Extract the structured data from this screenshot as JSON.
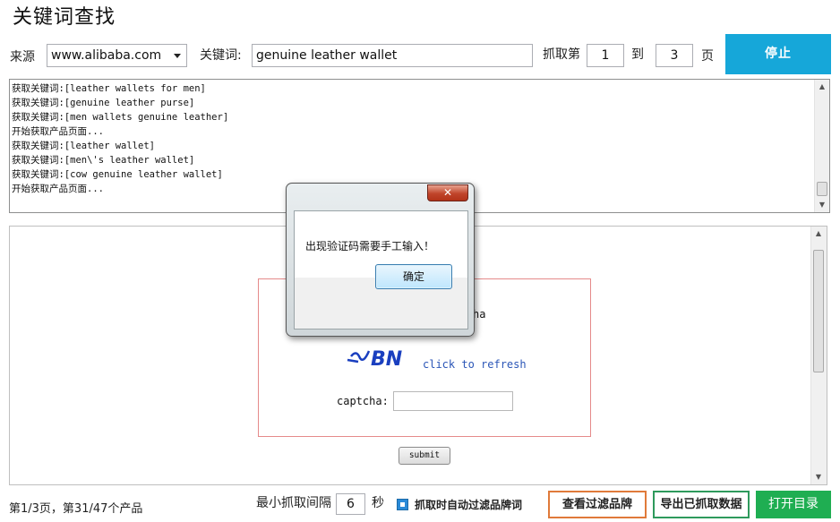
{
  "app": {
    "title": "关键词查找"
  },
  "toolbar": {
    "source_label": "来源",
    "source_value": "www.alibaba.com",
    "keyword_label": "关键词:",
    "keyword_value": "genuine leather wallet",
    "fetch_label": "抓取第",
    "page_from": "1",
    "to_label": "到",
    "page_to": "3",
    "page_unit": "页",
    "stop_label": "停止"
  },
  "log": {
    "lines": [
      "获取关键词:[leather wallets for men]",
      "获取关键词:[genuine leather purse]",
      "获取关键词:[men wallets genuine leather]",
      "开始获取产品页面...",
      "获取关键词:[leather wallet]",
      "获取关键词:[men\\'s leather wallet]",
      "获取关键词:[cow genuine leather wallet]",
      "开始获取产品页面..."
    ]
  },
  "captcha": {
    "partial_text": "ha",
    "image_text": "ﾉ‸BN",
    "refresh_label": "click to refresh",
    "input_label": "captcha:",
    "input_value": "",
    "submit_label": "submit"
  },
  "dialog": {
    "close_label": "✕",
    "message": "出现验证码需要手工输入！",
    "ok_label": "确定"
  },
  "footer": {
    "status": "第1/3页，第31/47个产品",
    "interval_label": "最小抓取间隔",
    "interval_value": "6",
    "interval_unit": "秒",
    "auto_filter_label": "抓取时自动过滤品牌词",
    "auto_filter_checked": true,
    "view_filter_label": "查看过滤品牌",
    "export_label": "导出已抓取数据",
    "open_dir_label": "打开目录"
  },
  "colors": {
    "stop_button": "#16a7d9",
    "open_button": "#1fae52",
    "view_filter_border": "#e07a3a",
    "export_border": "#2e9a5c",
    "captcha_border": "#e58a8a",
    "link": "#2b56b7"
  }
}
